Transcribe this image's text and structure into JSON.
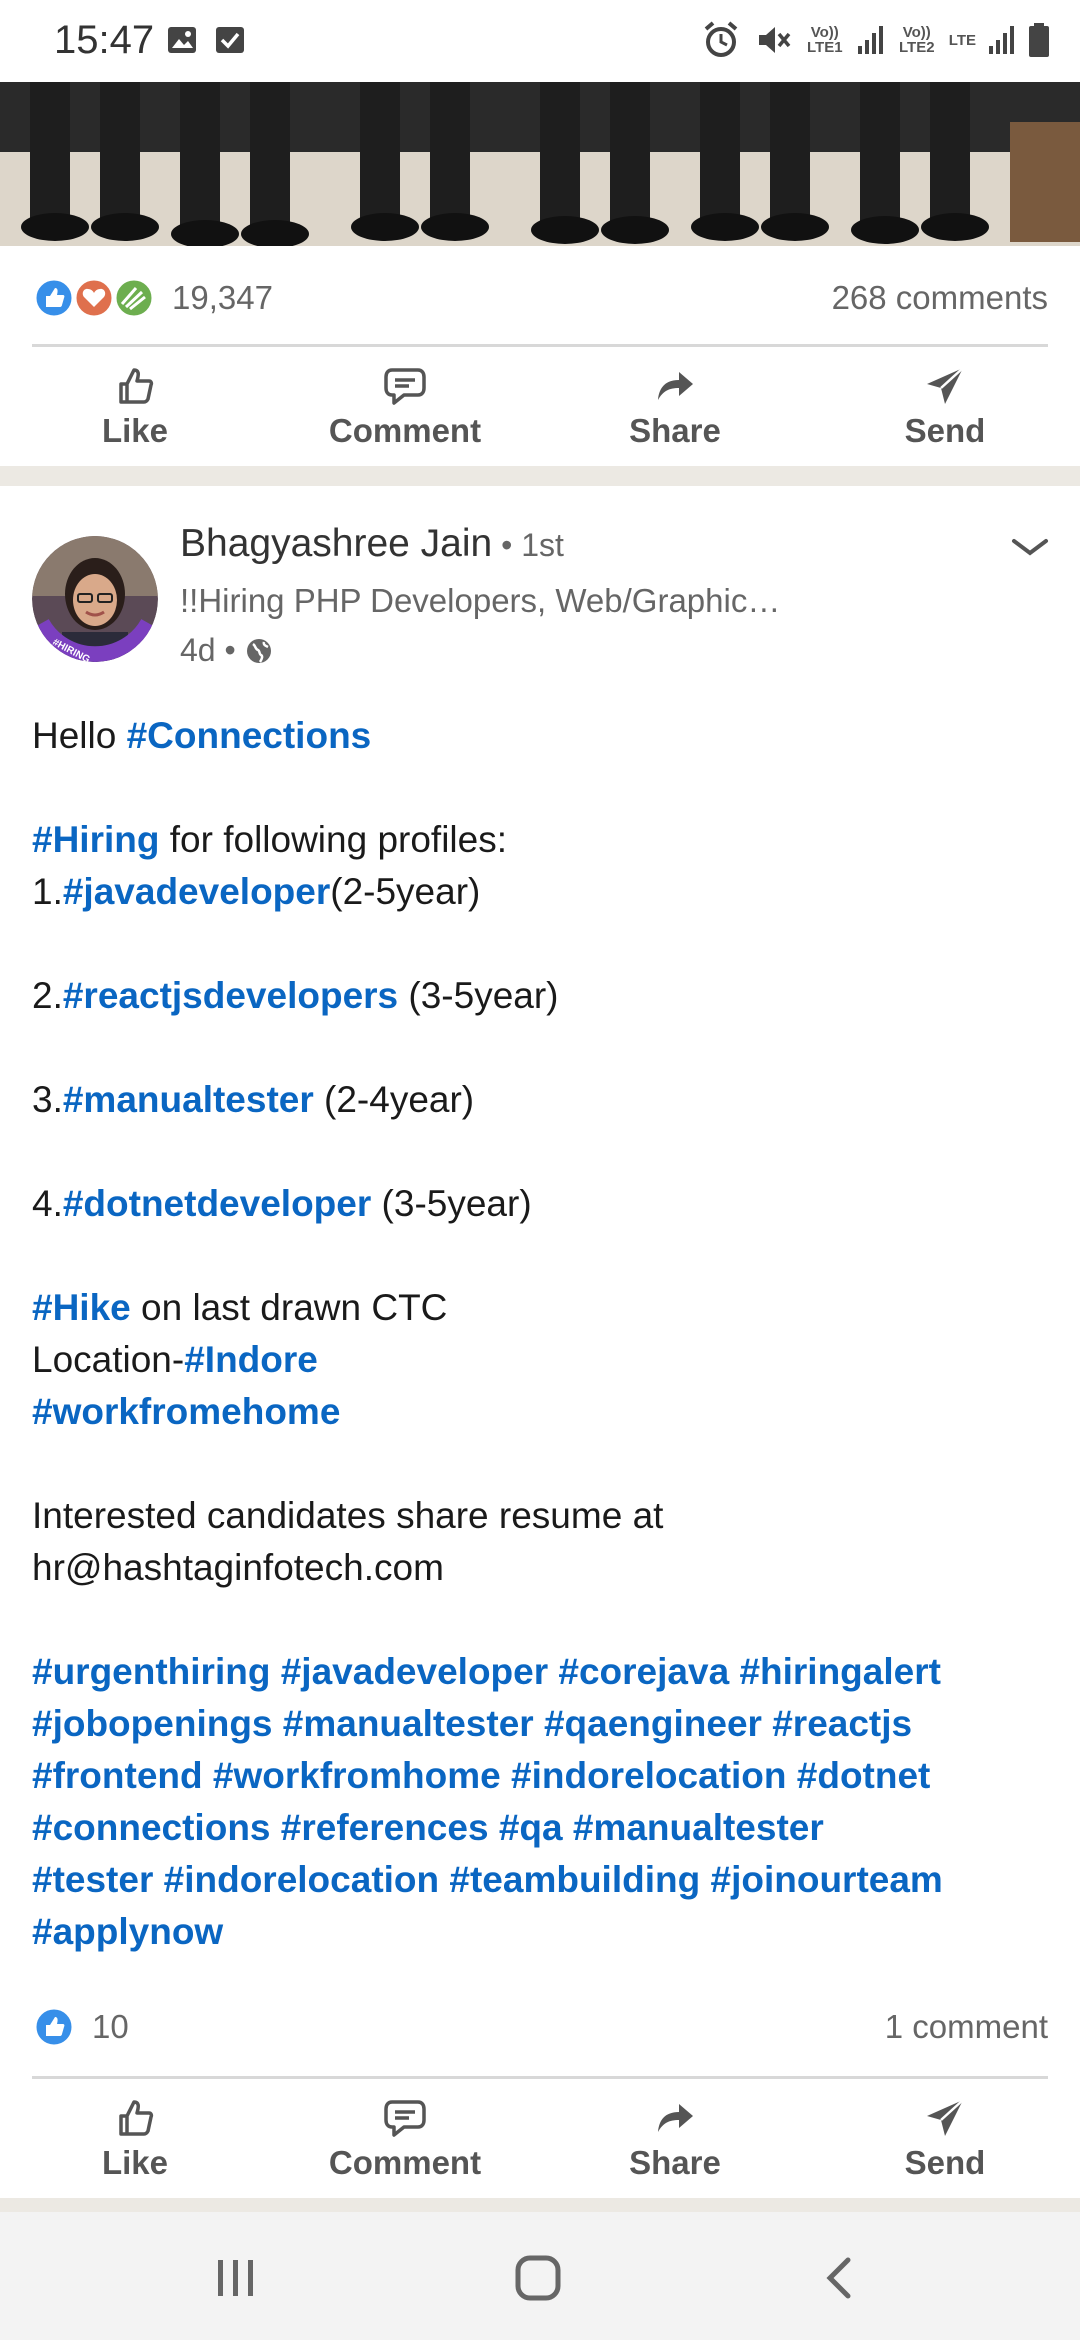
{
  "status_bar": {
    "time": "15:47",
    "net1": "Vo)) LTE1",
    "net2": "Vo)) LTE2",
    "lte": "LTE"
  },
  "prev_post": {
    "reactions_count": "19,347",
    "comments_count": "268 comments",
    "actions": {
      "like": "Like",
      "comment": "Comment",
      "share": "Share",
      "send": "Send"
    }
  },
  "post": {
    "author": "Bhagyashree Jain",
    "degree": " • 1st",
    "headline": "!!Hiring PHP Developers, Web/Graphic…",
    "time": "4d •",
    "avatar_badge": "#HIRING",
    "body": {
      "l1_text": "Hello ",
      "l1_tag": "#Connections",
      "l2_tag": "#Hiring",
      "l2_text": " for following profiles:",
      "l3_num": "1.",
      "l3_tag": "#javadeveloper",
      "l3_text": "(2-5year)",
      "l4_num": "2.",
      "l4_tag": "#reactjsdevelopers",
      "l4_text": " (3-5year)",
      "l5_num": "3.",
      "l5_tag": "#manualtester",
      "l5_text": " (2-4year)",
      "l6_num": "4.",
      "l6_tag": "#dotnetdeveloper",
      "l6_text": " (3-5year)",
      "l7_tag": "#Hike",
      "l7_text": " on last drawn CTC",
      "l8_text": "Location-",
      "l8_tag": "#Indore",
      "l9_tag": "#workfromehome",
      "l10_text": "Interested candidates share resume at",
      "l11_text": "hr@hashtaginfotech.com",
      "h1": "#urgenthiring",
      "h2": "#javadeveloper",
      "h3": "#corejava",
      "h4": "#hiringalert",
      "h5": "#jobopenings",
      "h6": "#manualtester",
      "h7": "#qaengineer",
      "h8": "#reactjs",
      "h9": "#frontend",
      "h10": "#workfromhome",
      "h11": "#indorelocation",
      "h12": "#dotnet",
      "h13": "#connections",
      "h14": "#references",
      "h15": "#qa",
      "h16": "#manualtester",
      "h17": "#tester",
      "h18": "#indorelocation",
      "h19": "#teambuilding",
      "h20": "#joinourteam",
      "h21": "#applynow"
    },
    "reactions_count": "10",
    "comments_count": "1 comment",
    "actions": {
      "like": "Like",
      "comment": "Comment",
      "share": "Share",
      "send": "Send"
    }
  },
  "colors": {
    "link": "#0a66c2",
    "like_blue": "#378fe9",
    "separator": "#ece9e3"
  }
}
